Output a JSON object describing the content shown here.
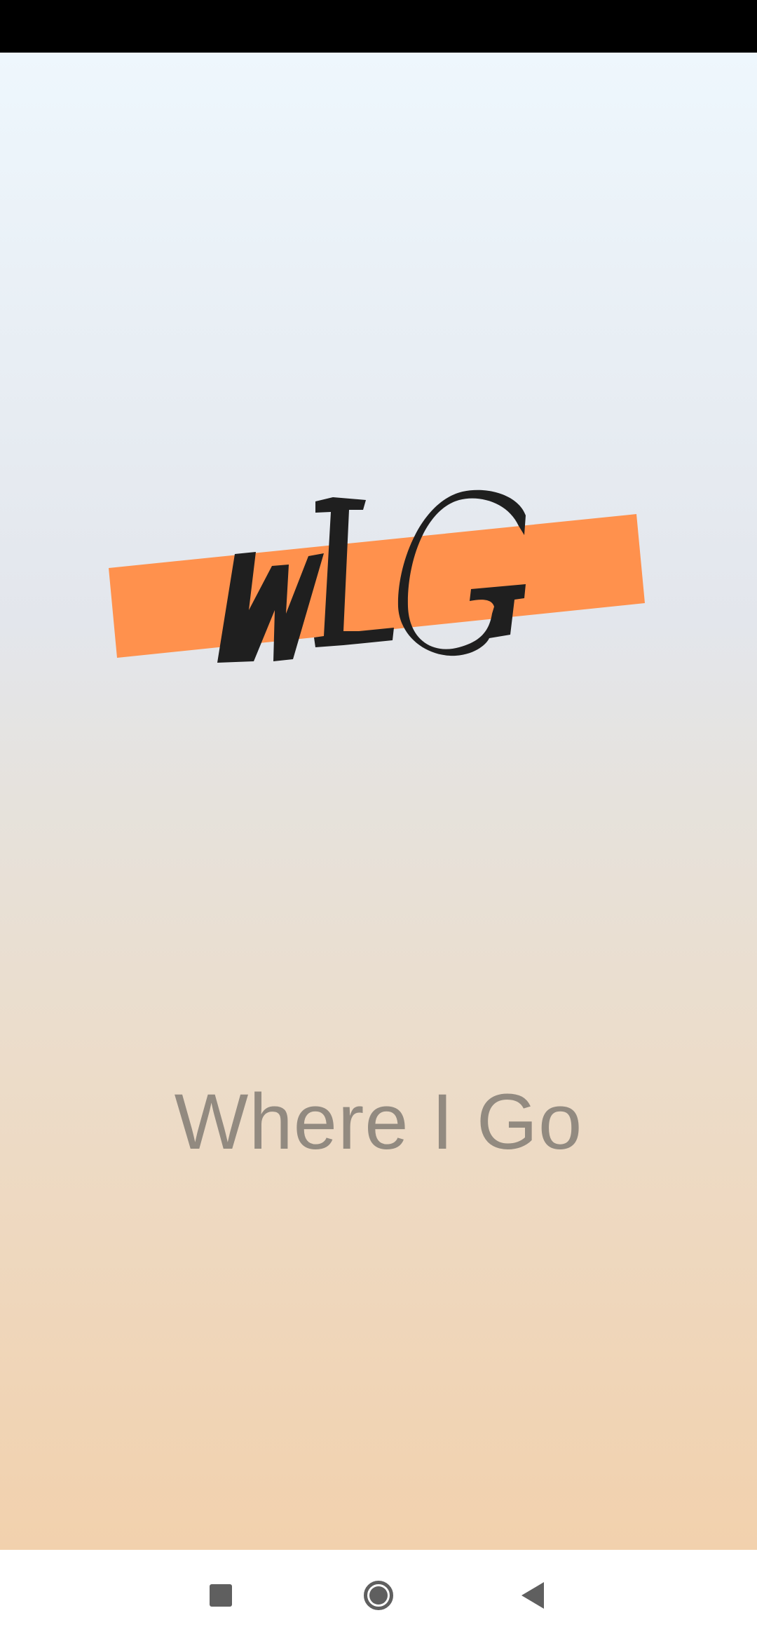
{
  "app": {
    "logo_text": "WIG",
    "tagline": "Where I Go"
  },
  "colors": {
    "logo_band": "#ff914d",
    "logo_ink": "#1f1f1f",
    "tagline": "#928a80",
    "gradient_top": "#eef7fd",
    "gradient_bottom": "#f2d1ad"
  },
  "nav": {
    "recents_icon": "square-icon",
    "home_icon": "circle-icon",
    "back_icon": "triangle-back-icon"
  }
}
